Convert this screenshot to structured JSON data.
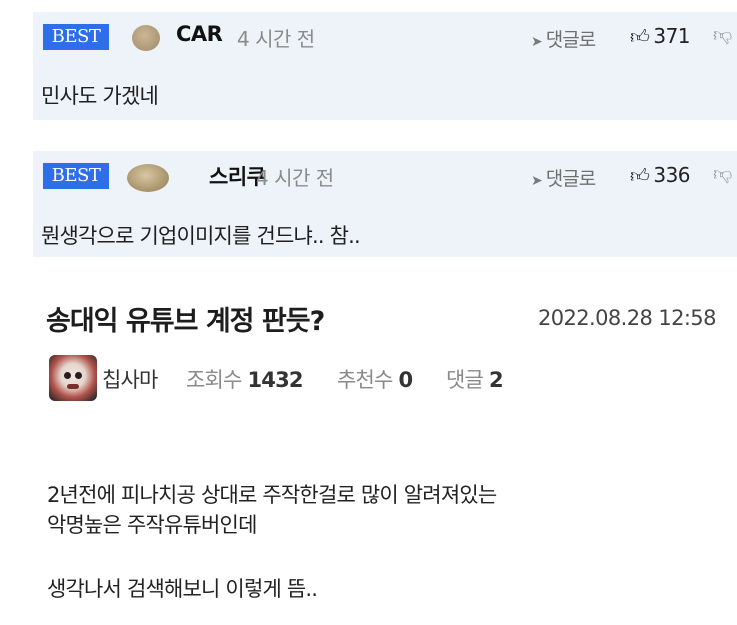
{
  "comments": [
    {
      "badge": "BEST",
      "nickname": "CAR",
      "time": "4 시간 전",
      "reply_label": "댓글로",
      "likes": "371",
      "body": "민사도 가겠네"
    },
    {
      "badge": "BEST",
      "nickname": "스리쿠",
      "time": "4 시간 전",
      "reply_label": "댓글로",
      "likes": "336",
      "body": "뭔생각으로 기업이미지를 건드냐.. 참.."
    }
  ],
  "post": {
    "title": "송대익 유튜브 계정 판듯?",
    "date": "2022.08.28 12:58",
    "author": "칩사마",
    "views_label": "조회수",
    "views": "1432",
    "recommend_label": "추천수",
    "recommend": "0",
    "comments_label": "댓글",
    "comments": "2",
    "lines": [
      "2년전에 피나치공 상대로 주작한걸로 많이 알려져있는",
      "악명높은 주작유튜버인데",
      "생각나서 검색해보니 이렇게 뜸.."
    ]
  },
  "colors": {
    "comment_bg": "#eef3fa",
    "best_badge": "#2e6ee8"
  },
  "icons": {
    "reply": "arrow-reply-icon",
    "like": "thumbs-up-icon",
    "dislike": "thumbs-down-icon"
  }
}
